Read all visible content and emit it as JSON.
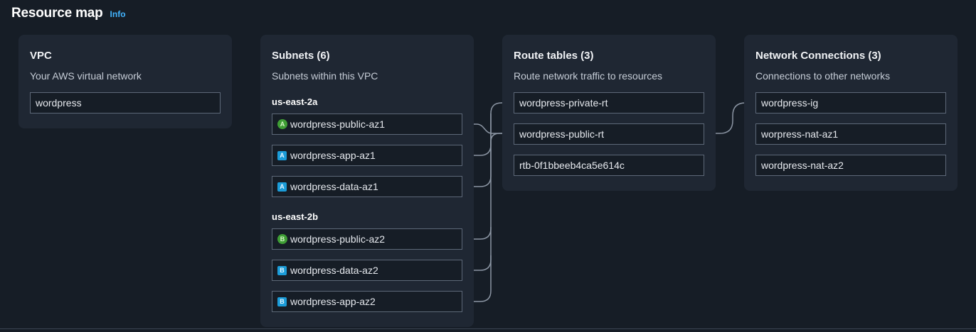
{
  "header": {
    "title": "Resource map",
    "info_label": "Info"
  },
  "vpc": {
    "title": "VPC",
    "subtitle": "Your AWS virtual network",
    "items": [
      "wordpress"
    ]
  },
  "subnets": {
    "title": "Subnets (6)",
    "subtitle": "Subnets within this VPC",
    "groups": [
      {
        "az": "us-east-2a",
        "items": [
          {
            "badge": "A",
            "badge_style": "public-circle",
            "name": "wordpress-public-az1"
          },
          {
            "badge": "A",
            "badge_style": "private-square",
            "name": "wordpress-app-az1"
          },
          {
            "badge": "A",
            "badge_style": "private-square",
            "name": "wordpress-data-az1"
          }
        ]
      },
      {
        "az": "us-east-2b",
        "items": [
          {
            "badge": "B",
            "badge_style": "public-circle",
            "name": "wordpress-public-az2"
          },
          {
            "badge": "B",
            "badge_style": "private-square",
            "name": "wordpress-data-az2"
          },
          {
            "badge": "B",
            "badge_style": "private-square",
            "name": "wordpress-app-az2"
          }
        ]
      }
    ]
  },
  "route_tables": {
    "title": "Route tables (3)",
    "subtitle": "Route network traffic to resources",
    "items": [
      "wordpress-private-rt",
      "wordpress-public-rt",
      "rtb-0f1bbeeb4ca5e614c"
    ]
  },
  "network_connections": {
    "title": "Network Connections (3)",
    "subtitle": "Connections to other networks",
    "items": [
      "wordpress-ig",
      "worpress-nat-az1",
      "wordpress-nat-az2"
    ]
  },
  "colors": {
    "background": "#161d26",
    "panel": "#1f2733",
    "item_border": "#5d6878",
    "connector": "#8b95a3",
    "link": "#42b4ff",
    "public_badge": "#3f9e35",
    "private_badge": "#1b9cd8"
  }
}
